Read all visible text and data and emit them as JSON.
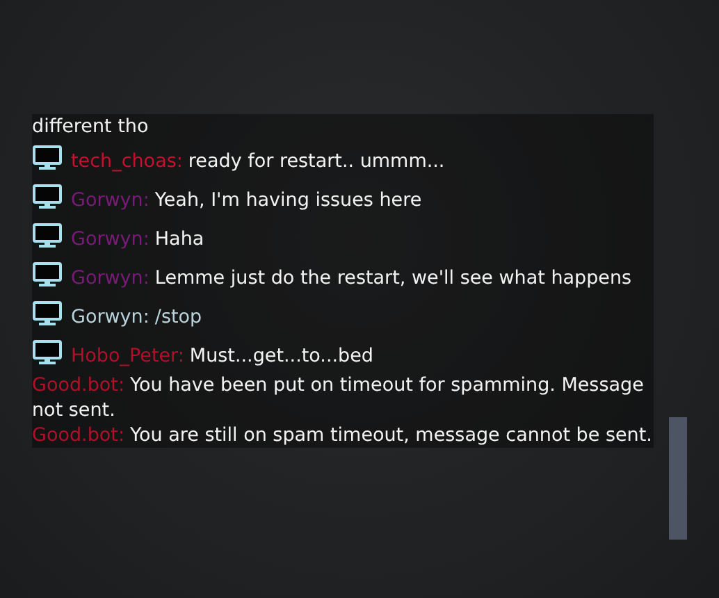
{
  "chat": {
    "messages": [
      {
        "kind": "continuation",
        "text": "different tho"
      },
      {
        "kind": "user",
        "name": "tech_choas:",
        "color": "#c8102e",
        "text": "ready for restart.. ummm..."
      },
      {
        "kind": "user",
        "name": "Gorwyn:",
        "color": "#7a1a7a",
        "text": "Yeah, I'm having issues here"
      },
      {
        "kind": "user",
        "name": "Gorwyn:",
        "color": "#7a1a7a",
        "text": "Haha"
      },
      {
        "kind": "user",
        "name": "Gorwyn:",
        "color": "#7a1a7a",
        "text": "Lemme just do the restart, we'll see what happens"
      },
      {
        "kind": "command",
        "name": "Gorwyn:",
        "color": "#b9d3dc",
        "text": "/stop"
      },
      {
        "kind": "user",
        "name": "Hobo_Peter:",
        "color": "#b0102a",
        "text": "Must...get...to...bed"
      },
      {
        "kind": "bot",
        "name": "Good.bot:",
        "color": "#b0102a",
        "text": "You have been put on timeout for spamming. Message not sent."
      },
      {
        "kind": "bot",
        "name": "Good.bot:",
        "color": "#b0102a",
        "text": "You are still on spam timeout, message cannot be sent."
      }
    ]
  }
}
